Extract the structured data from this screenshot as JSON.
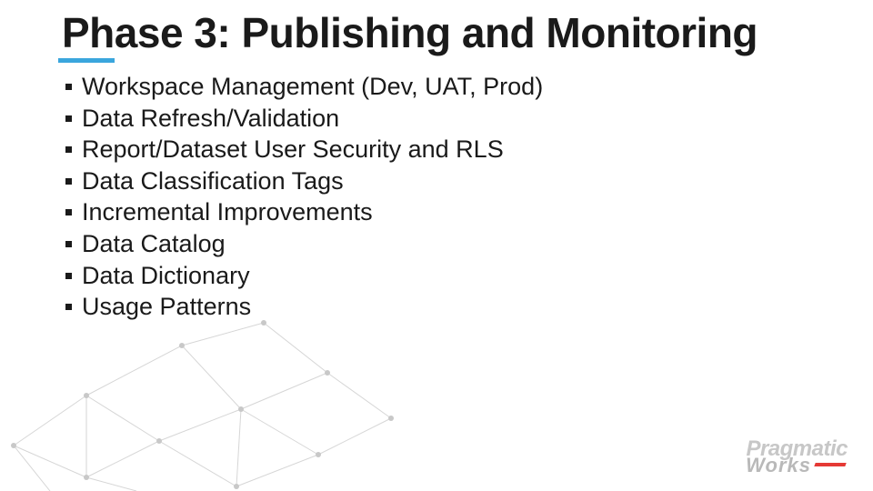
{
  "title": "Phase 3: Publishing and Monitoring",
  "bullets": [
    "Workspace Management (Dev, UAT, Prod)",
    "Data Refresh/Validation",
    "Report/Dataset User Security and RLS",
    "Data Classification Tags",
    "Incremental Improvements",
    "Data Catalog",
    "Data Dictionary",
    "Usage Patterns"
  ],
  "logo": {
    "word1": "Pragmatic",
    "word2": "Works"
  },
  "colors": {
    "title_underline": "#3aa6dd",
    "logo_accent": "#e53935",
    "mesh_line": "#d6d6d6",
    "mesh_dot": "#c8c8c8"
  }
}
